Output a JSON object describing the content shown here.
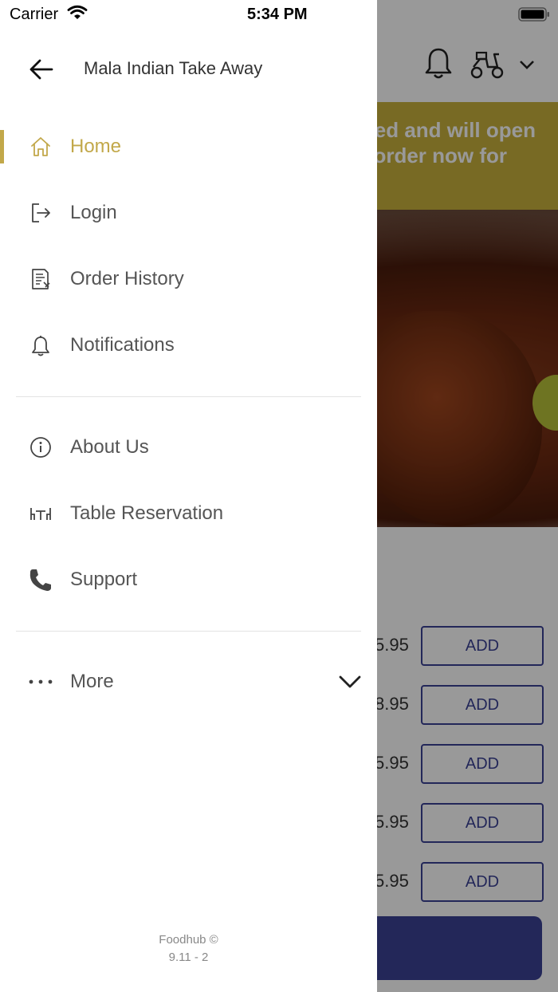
{
  "status_bar": {
    "carrier": "Carrier",
    "time": "5:34 PM"
  },
  "background": {
    "banner_line1": "ed and will open",
    "banner_line2": "order now for",
    "prices": [
      ".95",
      ".95",
      ".95",
      ".95",
      ".95"
    ],
    "price_prefixes": [
      "5",
      "8",
      "5",
      "5",
      "5"
    ],
    "add_label": "ADD",
    "icons": [
      "bell-icon",
      "scooter-icon",
      "chevron-down-icon"
    ]
  },
  "drawer": {
    "title": "Mala Indian Take Away",
    "back_icon": "arrow-left-icon",
    "primary_items": [
      {
        "label": "Home",
        "icon": "home-icon",
        "active": true
      },
      {
        "label": "Login",
        "icon": "login-icon",
        "active": false
      },
      {
        "label": "Order History",
        "icon": "receipt-icon",
        "active": false
      },
      {
        "label": "Notifications",
        "icon": "bell-icon",
        "active": false
      }
    ],
    "secondary_items": [
      {
        "label": "About Us",
        "icon": "info-icon"
      },
      {
        "label": "Table Reservation",
        "icon": "table-icon"
      },
      {
        "label": "Support",
        "icon": "phone-icon"
      }
    ],
    "more": {
      "label": "More",
      "icon": "dots-icon",
      "chevron": "chevron-down-icon"
    },
    "footer": {
      "brand": "Foodhub ©",
      "version": "9.11 - 2"
    }
  },
  "colors": {
    "accent": "#c2a84a",
    "text": "#555555",
    "banner": "#c8b13c",
    "button_blue": "#3b4294",
    "overlay": "rgba(0,0,0,0.4)"
  }
}
